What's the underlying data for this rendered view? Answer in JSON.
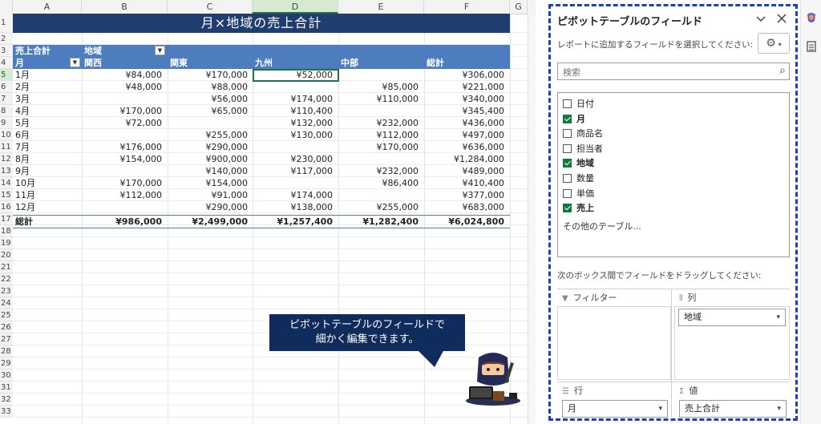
{
  "sheet": {
    "columns": [
      "A",
      "B",
      "C",
      "D",
      "E",
      "F",
      "G"
    ],
    "selected_column": "D",
    "rows": [
      "1",
      "2",
      "3",
      "4",
      "5",
      "6",
      "7",
      "8",
      "9",
      "10",
      "11",
      "12",
      "13",
      "14",
      "15",
      "16",
      "17",
      "18",
      "19",
      "20",
      "21",
      "22",
      "23",
      "24",
      "25",
      "26",
      "27",
      "28",
      "29",
      "30",
      "31",
      "32",
      "33"
    ],
    "selected_row": "5",
    "title": "月×地域の売上合計",
    "value_caption": "売上合計",
    "col_caption": "地域",
    "row_caption": "月",
    "regions": [
      "関西",
      "関東",
      "九州",
      "中部",
      "総計"
    ],
    "data_rows": [
      {
        "month": "1月",
        "values": [
          "¥84,000",
          "¥170,000",
          "¥52,000",
          "",
          "¥306,000"
        ]
      },
      {
        "month": "2月",
        "values": [
          "¥48,000",
          "¥88,000",
          "",
          "¥85,000",
          "¥221,000"
        ]
      },
      {
        "month": "3月",
        "values": [
          "",
          "¥56,000",
          "¥174,000",
          "¥110,000",
          "¥340,000"
        ]
      },
      {
        "month": "4月",
        "values": [
          "¥170,000",
          "¥65,000",
          "¥110,400",
          "",
          "¥345,400"
        ]
      },
      {
        "month": "5月",
        "values": [
          "¥72,000",
          "",
          "¥132,000",
          "¥232,000",
          "¥436,000"
        ]
      },
      {
        "month": "6月",
        "values": [
          "",
          "¥255,000",
          "¥130,000",
          "¥112,000",
          "¥497,000"
        ]
      },
      {
        "month": "7月",
        "values": [
          "¥176,000",
          "¥290,000",
          "",
          "¥170,000",
          "¥636,000"
        ]
      },
      {
        "month": "8月",
        "values": [
          "¥154,000",
          "¥900,000",
          "¥230,000",
          "",
          "¥1,284,000"
        ]
      },
      {
        "month": "9月",
        "values": [
          "",
          "¥140,000",
          "¥117,000",
          "¥232,000",
          "¥489,000"
        ]
      },
      {
        "month": "10月",
        "values": [
          "¥170,000",
          "¥154,000",
          "",
          "¥86,400",
          "¥410,400"
        ]
      },
      {
        "month": "11月",
        "values": [
          "¥112,000",
          "¥91,000",
          "¥174,000",
          "",
          "¥377,000"
        ]
      },
      {
        "month": "12月",
        "values": [
          "",
          "¥290,000",
          "¥138,000",
          "¥255,000",
          "¥683,000"
        ]
      }
    ],
    "total_row": {
      "label": "総計",
      "values": [
        "¥986,000",
        "¥2,499,000",
        "¥1,257,400",
        "¥1,282,400",
        "¥6,024,800"
      ]
    }
  },
  "callout": {
    "line1": "ピボットテーブルのフィールドで",
    "line2": "細かく編集できます。"
  },
  "pane": {
    "title": "ピボットテーブルのフィールド",
    "subtitle": "レポートに追加するフィールドを選択してください:",
    "search_placeholder": "検索",
    "fields": [
      {
        "label": "日付",
        "checked": false
      },
      {
        "label": "月",
        "checked": true
      },
      {
        "label": "商品名",
        "checked": false
      },
      {
        "label": "担当者",
        "checked": false
      },
      {
        "label": "地域",
        "checked": true
      },
      {
        "label": "数量",
        "checked": false
      },
      {
        "label": "単価",
        "checked": false
      },
      {
        "label": "売上",
        "checked": true
      }
    ],
    "more_tables": "その他のテーブル...",
    "drag_hint": "次のボックス間でフィールドをドラッグしてください:",
    "areas": {
      "filter": "フィルター",
      "columns": "列",
      "rows": "行",
      "values": "値"
    },
    "columns_item": "地域",
    "rows_item": "月",
    "values_item": "売上合計"
  },
  "colors": {
    "title_band": "#1f3d6e",
    "header_band": "#4e7dbf",
    "checkbox_on": "#0f7a3c",
    "pane_border": "#1a3fc9",
    "callout_bg": "#102c5c"
  }
}
